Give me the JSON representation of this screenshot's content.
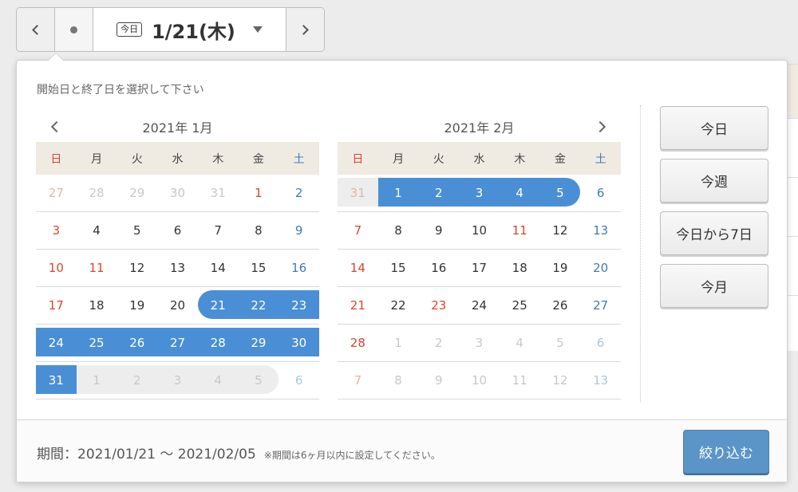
{
  "nav": {
    "today_tag": "今日",
    "current_date": "1/21(木)"
  },
  "picker": {
    "instruction": "開始日と終了日を選択して下さい",
    "weekdays": [
      "日",
      "月",
      "火",
      "水",
      "木",
      "金",
      "土"
    ],
    "months": [
      {
        "title": "2021年 1月",
        "days": [
          "27",
          "28",
          "29",
          "30",
          "31",
          "1",
          "2",
          "3",
          "4",
          "5",
          "6",
          "7",
          "8",
          "9",
          "10",
          "11",
          "12",
          "13",
          "14",
          "15",
          "16",
          "17",
          "18",
          "19",
          "20",
          "21",
          "22",
          "23",
          "24",
          "25",
          "26",
          "27",
          "28",
          "29",
          "30",
          "31",
          "1",
          "2",
          "3",
          "4",
          "5",
          "6"
        ]
      },
      {
        "title": "2021年 2月",
        "days": [
          "31",
          "1",
          "2",
          "3",
          "4",
          "5",
          "6",
          "7",
          "8",
          "9",
          "10",
          "11",
          "12",
          "13",
          "14",
          "15",
          "16",
          "17",
          "18",
          "19",
          "20",
          "21",
          "22",
          "23",
          "24",
          "25",
          "26",
          "27",
          "28",
          "1",
          "2",
          "3",
          "4",
          "5",
          "6",
          "7",
          "8",
          "9",
          "10",
          "11",
          "12",
          "13"
        ]
      }
    ],
    "quick_buttons": [
      "今日",
      "今週",
      "今日から7日",
      "今月"
    ],
    "period_label": "期間：2021/01/21 〜 2021/02/05",
    "period_note": "※期間は6ヶ月以内に設定してください。",
    "apply_label": "絞り込む"
  },
  "colors": {
    "selected": "#4a8fd6",
    "sunday": "#d9462c",
    "saturday": "#3f7bb5",
    "apply_button": "#5b95c8",
    "weekday_header": "#efebe3"
  },
  "icons": {
    "prev": "chevron-left-icon",
    "next": "chevron-right-icon",
    "dot": "dot-icon",
    "dropdown": "caret-down-icon"
  }
}
